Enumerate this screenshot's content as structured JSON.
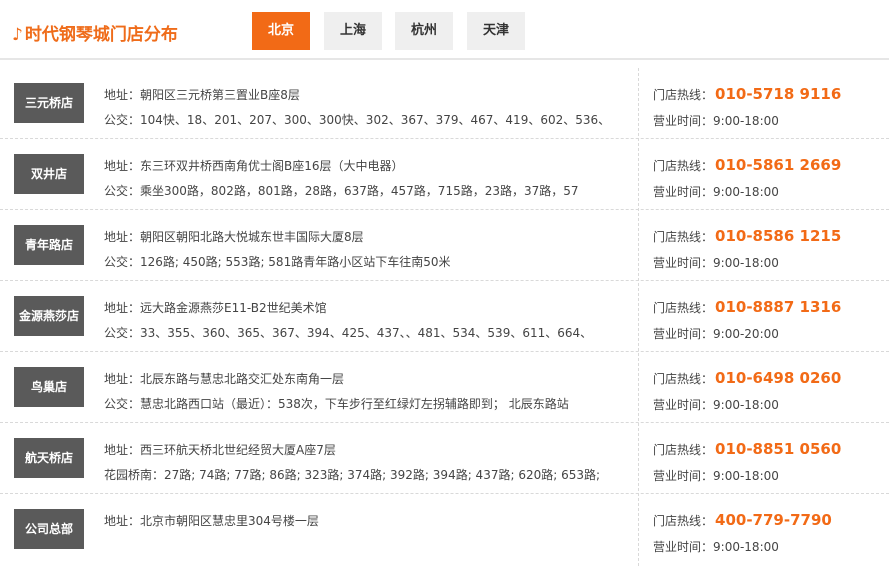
{
  "header": {
    "title": "时代钢琴城门店分布",
    "note_icon": "♪",
    "tabs": [
      "北京",
      "上海",
      "杭州",
      "天津"
    ],
    "active_tab": 0
  },
  "labels": {
    "address": "地址：",
    "bus": "公交：",
    "hotline": "门店热线：",
    "hours": "营业时间："
  },
  "stores": [
    {
      "name": "三元桥店",
      "address": "朝阳区三元桥第三置业B座8层",
      "bus_prefix": "公交：",
      "bus": "104快、18、201、207、300、300快、302、367、379、467、419、602、536、",
      "phone": "010-5718 9116",
      "hours": "9:00-18:00"
    },
    {
      "name": "双井店",
      "address": "东三环双井桥西南角优士阁B座16层（大中电器）",
      "bus_prefix": "公交：",
      "bus": "乘坐300路，802路，801路，28路，637路，457路，715路，23路，37路，57",
      "phone": "010-5861 2669",
      "hours": "9:00-18:00"
    },
    {
      "name": "青年路店",
      "address": "朝阳区朝阳北路大悦城东世丰国际大厦8层",
      "bus_prefix": "公交：",
      "bus": "126路; 450路; 553路; 581路青年路小区站下车往南50米",
      "phone": "010-8586 1215",
      "hours": "9:00-18:00"
    },
    {
      "name": "金源燕莎店",
      "address": "远大路金源燕莎E11-B2世纪美术馆",
      "bus_prefix": "公交：",
      "bus": "33、355、360、365、367、394、425、437、、481、534、539、611、664、",
      "phone": "010-8887 1316",
      "hours": "9:00-20:00"
    },
    {
      "name": "鸟巢店",
      "address": "北辰东路与慧忠北路交汇处东南角一层",
      "bus_prefix": "公交：",
      "bus": "慧忠北路西口站（最近）：538次，下车步行至红绿灯左拐辅路即到； 北辰东路站",
      "phone": "010-6498 0260",
      "hours": "9:00-18:00"
    },
    {
      "name": "航天桥店",
      "address": "西三环航天桥北世纪经贸大厦A座7层",
      "bus_prefix": "",
      "bus": "花园桥南：27路; 74路; 77路; 86路; 323路; 374路; 392路; 394路; 437路; 620路; 653路;",
      "phone": "010-8851 0560",
      "hours": "9:00-18:00"
    },
    {
      "name": "公司总部",
      "address": "北京市朝阳区慧忠里304号楼一层",
      "bus_prefix": "",
      "bus": "",
      "phone": "400-779-7790",
      "hours": "9:00-18:00"
    }
  ]
}
